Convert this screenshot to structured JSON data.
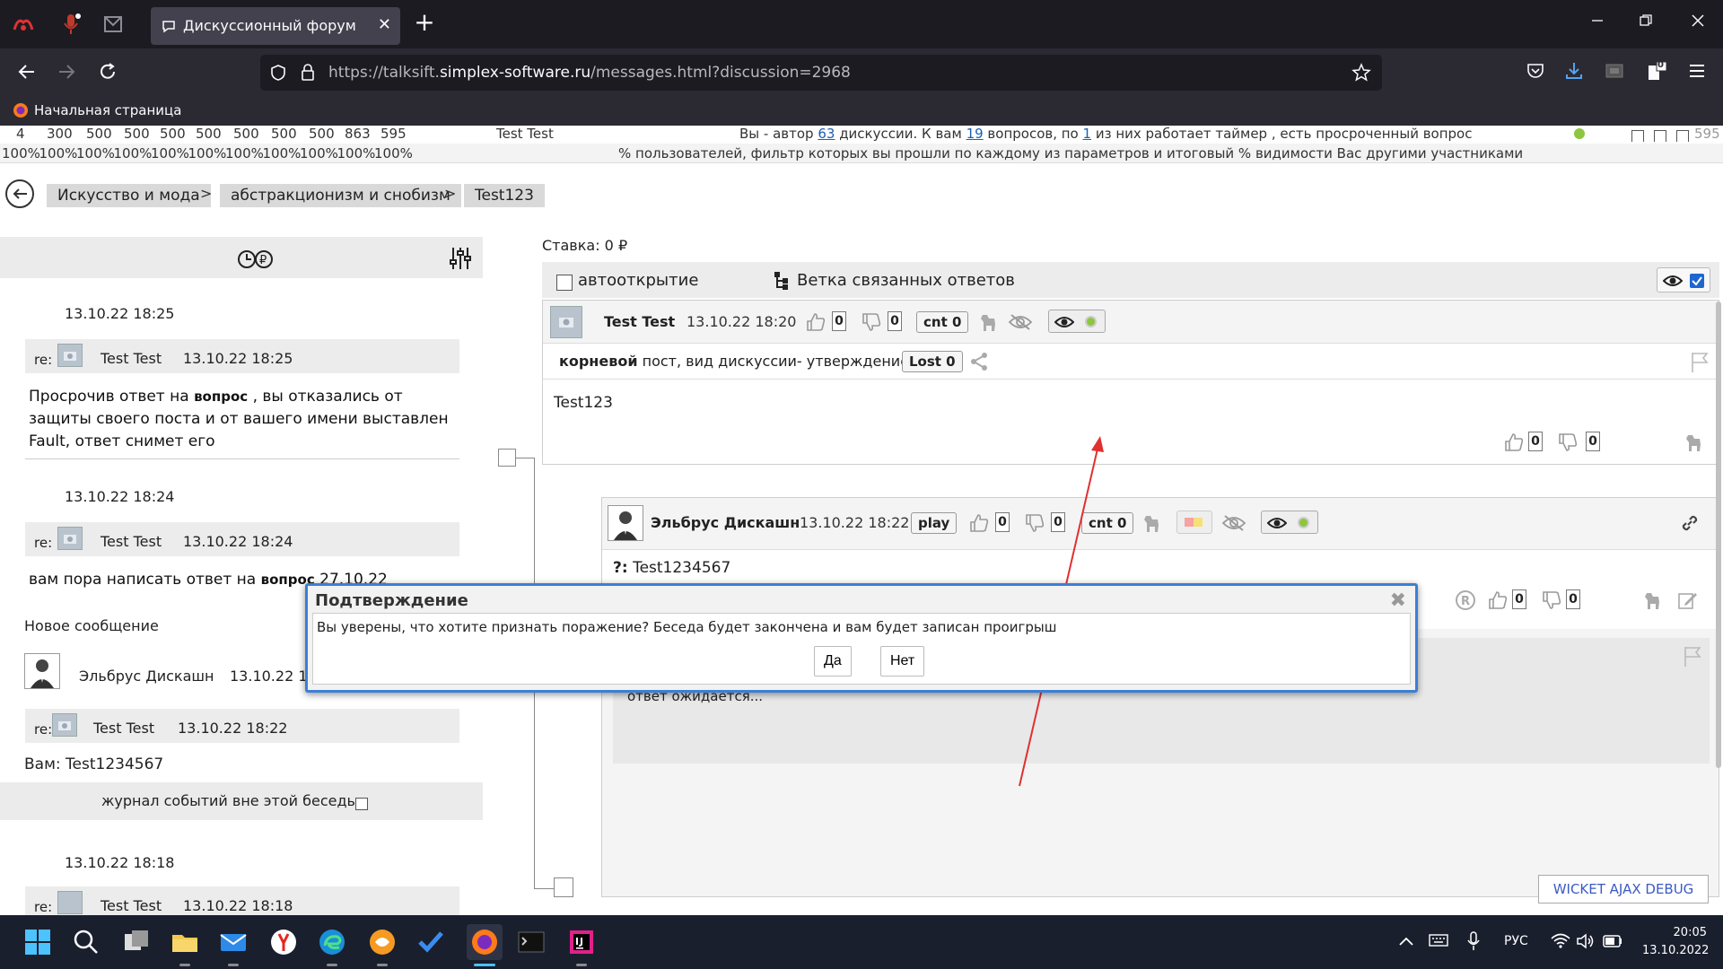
{
  "browser": {
    "tab_title": "Дискуссионный форум",
    "tab_close": "✕",
    "new_tab": "+",
    "url_prefix": "https://talksift.",
    "url_domain": "simplex-software.ru",
    "url_path": "/messages.html?discussion=2968",
    "bookmark": "Начальная страница",
    "ext_badge": "0"
  },
  "stats": {
    "row1_numbers": [
      "4",
      "300",
      "500",
      "500",
      "500",
      "500",
      "500",
      "500",
      "500",
      "863",
      "595"
    ],
    "row1_name": "Test Test",
    "row1_text_a": "Вы - автор ",
    "row1_link1": "63",
    "row1_text_b": " дискуссии. К вам ",
    "row1_link2": "19",
    "row1_text_c": " вопросов, по ",
    "row1_link3": "1",
    "row1_text_d": " из них работает таймер , есть просроченный вопрос",
    "row1_end": "595",
    "row2_percents": [
      "100%",
      "100%",
      "100%",
      "100%",
      "100%",
      "100%",
      "100%",
      "100%",
      "100%",
      "100%",
      "100%"
    ],
    "row2_text": "% пользователей, фильтр которых вы прошли по каждому из параметров и итоговый % видимости Вас другими участниками"
  },
  "breadcrumbs": [
    "Искусство и мода",
    "абстракционизм и снобизм",
    "Test123"
  ],
  "crumb_sep": ">",
  "left": {
    "events": [
      {
        "date": "13.10.22 18:25",
        "re": "re:",
        "name": "Test Test",
        "time": "13.10.22 18:25",
        "text_a": "Просрочив ответ на ",
        "link": "вопрос",
        "text_b": " , вы отказались от защиты своего поста и от вашего имени выставлен Fault, ответ снимет его"
      },
      {
        "date": "13.10.22 18:24",
        "re": "re:",
        "name": "Test Test",
        "time": "13.10.22 18:24",
        "text_a": "вам пора написать ответ на ",
        "link": "вопрос",
        "text_b": " 27.10.22"
      }
    ],
    "new_message_label": "Новое сообщение",
    "new_message_author": "Эльбрус Дискашн",
    "new_message_time": "13.10.22 18",
    "reply": {
      "re": "re:",
      "name": "Test Test",
      "time": "13.10.22 18:22"
    },
    "reply_text": "Вам: Test1234567",
    "journal_label": "журнал событий вне этой беседы",
    "last_date": "13.10.22 18:18",
    "last_name": "Test Test",
    "last_time": "13.10.22 18:18"
  },
  "right": {
    "stake": "Ставка: 0 ₽",
    "autoopen": "автооткрытие",
    "branch": "Ветка связанных ответов",
    "root_post": {
      "author": "Test Test",
      "time": "13.10.22 18:20",
      "likes": "0",
      "dislikes": "0",
      "cnt": "cnt 0",
      "kind_bold": "корневой",
      "kind_rest": " пост, вид дискуссии- утверждение",
      "lost": "Lost 0",
      "body": "Test123",
      "body_likes": "0",
      "body_dislikes": "0"
    },
    "reply_post": {
      "author": "Эльбрус Дискашн",
      "time": "13.10.22 18:22",
      "play": "play",
      "likes": "0",
      "dislikes": "0",
      "cnt": "cnt 0",
      "question_prefix": "?:",
      "question": " Test1234567",
      "q_likes": "0",
      "q_dislikes": "0",
      "awaiting": "ответ ожидается..."
    }
  },
  "dialog": {
    "title": "Подтверждение",
    "close": "✖",
    "message": "Вы уверены, что хотите признать поражение? Беседа будет закончена и вам будет записан проигрыш",
    "yes": "Да",
    "no": "Нет"
  },
  "debug_button": "WICKET AJAX DEBUG",
  "taskbar": {
    "lang": "РУС",
    "time": "20:05",
    "date": "13.10.2022"
  },
  "colors": {
    "chrome_dark": "#1c1b22",
    "chrome_mid": "#2b2a33",
    "dialog_border": "#3b7fd6",
    "link_blue": "#1a5fb4",
    "annotation_red": "#e03030"
  }
}
